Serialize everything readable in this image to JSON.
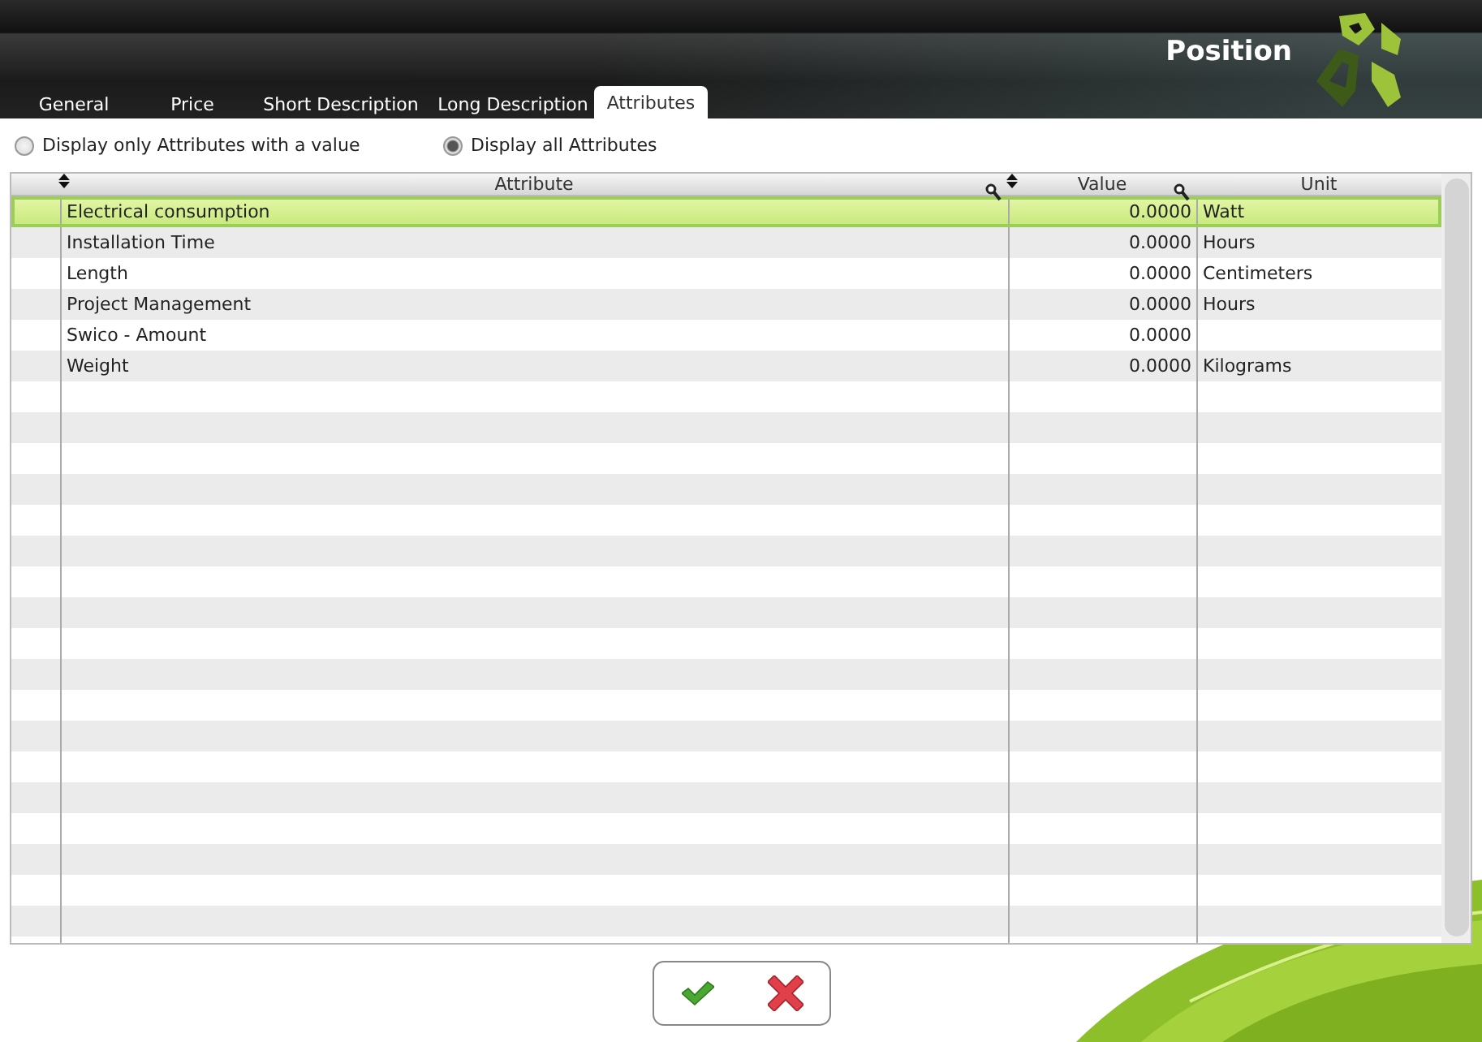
{
  "header": {
    "title": "Position"
  },
  "tabs": [
    {
      "label": "General",
      "selected": false
    },
    {
      "label": "Price",
      "selected": false
    },
    {
      "label": "Short Description",
      "selected": false
    },
    {
      "label": "Long Description",
      "selected": false
    },
    {
      "label": "Attributes",
      "selected": true
    }
  ],
  "filter": [
    {
      "label": "Display only Attributes with a value",
      "selected": false
    },
    {
      "label": "Display all Attributes",
      "selected": true
    }
  ],
  "table": {
    "columns": [
      "Attribute",
      "Value",
      "Unit"
    ],
    "rows": [
      {
        "attribute": "Electrical consumption",
        "value": "0.0000",
        "unit": "Watt",
        "selected": true
      },
      {
        "attribute": "Installation Time",
        "value": "0.0000",
        "unit": "Hours",
        "selected": false
      },
      {
        "attribute": "Length",
        "value": "0.0000",
        "unit": "Centimeters",
        "selected": false
      },
      {
        "attribute": "Project Management",
        "value": "0.0000",
        "unit": "Hours",
        "selected": false
      },
      {
        "attribute": "Swico - Amount",
        "value": "0.0000",
        "selected": false
      },
      {
        "attribute": "Weight",
        "value": "0.0000",
        "unit": "Kilograms",
        "selected": false
      }
    ]
  }
}
